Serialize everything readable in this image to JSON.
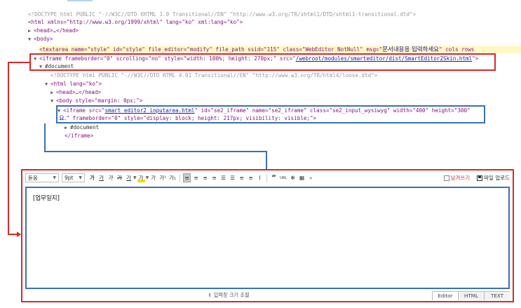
{
  "devtools": {
    "doctype1": "<!DOCTYPE html PUBLIC \"-//W3C//DTD XHTML 1.0 Transitional//EN\" \"http://www.w3.org/TR/xhtml1/DTD/xhtml1-transitional.dtd\">",
    "html_tag": "<html xmlns=\"http://www.w3.org/1999/xhtml\" lang=\"ko\" xml:lang=\"ko\">",
    "head_tag": "<head>…</head>",
    "body_tag": "<body>",
    "textarea_pre": "<textarea name=\"style\" id=\"style\" file_editor=\"modify\" file_path ssid=\"115\" class=\"WebEditor NotNull\" msg=\"",
    "textarea_msg": "문서내용을 입력하세요",
    "textarea_post": "\" cols rows",
    "iframe1_pre": "<iframe frameborder=\"0\" scrolling=\"no\" style=\"width: 100%; height: 270px;\" src=\"",
    "iframe1_src": "/webroot/modules/smarteditor/dist/SmartEditor2Skin.html",
    "iframe1_post": "\">",
    "document1": "#document",
    "doctype2": "<!DOCTYPE html PUBLIC \"-//W3C//DTD HTML 4.01 Transitional//EN\" \"http://www.w3.org/TR/html4/loose.dtd\">",
    "html2_tag": "<html lang=\"ko\">",
    "head2_tag": "<head>…</head>",
    "body2_tag": "<body style=\"margin: 0px;\">",
    "iframe2_pre": "<iframe src=\"",
    "iframe2_src": "smart_editor2_inputarea.html",
    "iframe2_post": "\" id=\"se2_iframe\" name=\"se2_iframe\" class=\"se2_input_wysiwyg\" width=\"400\" height=\"300\"",
    "iframe2_line2_ko": "요.",
    "iframe2_line2": "\" frameborder=\"0\" style=\"display: block; height: 217px; visibility: visible;\">",
    "document2": "#document",
    "iframe_close": "</iframe>"
  },
  "editor": {
    "font_family": "돋움",
    "font_size": "9pt",
    "format_buttons": [
      "가",
      "가",
      "가",
      "가",
      "가",
      "가",
      "가",
      "가¹",
      "가₁"
    ],
    "align_buttons": [
      "≡",
      "≡",
      "≡",
      "≡",
      "☰",
      "☰",
      "≡",
      "≡",
      "I"
    ],
    "insert_buttons": [
      "“",
      "URL",
      "✻",
      "▦",
      "⌕"
    ],
    "preview_label": "남겨쓰기",
    "upload_label": "파일 업로드",
    "content_text": "[업무일지]",
    "resize_label": "⇕ 입력창 크기 조절",
    "tabs": [
      "Editor",
      "HTML",
      "TEXT"
    ]
  },
  "colors": {
    "red_box": "#d9282c",
    "blue_box": "#3a70b8"
  }
}
